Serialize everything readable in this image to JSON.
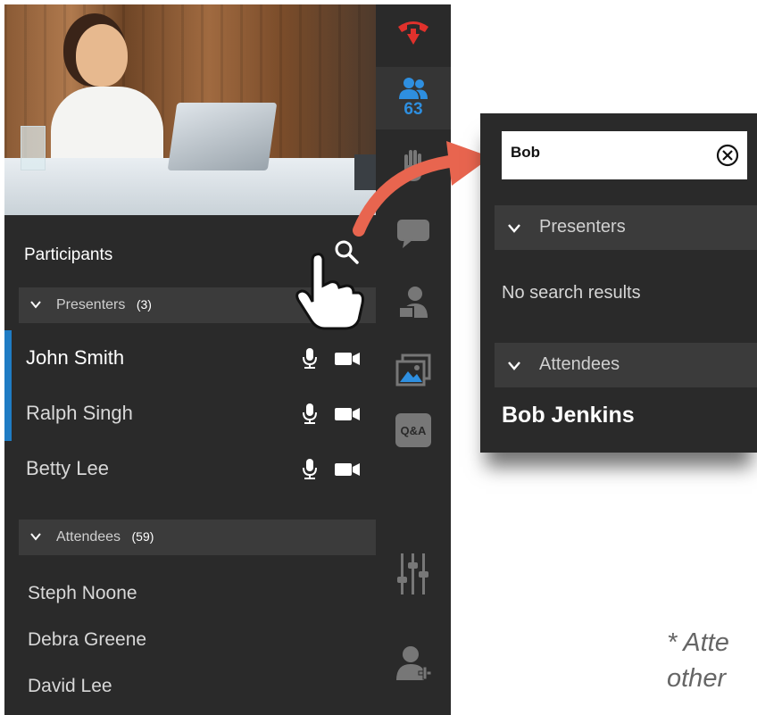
{
  "panel": {
    "title": "Participants",
    "presenters_label": "Presenters",
    "presenters_count": "(3)",
    "presenters": [
      {
        "name": "John Smith",
        "active": true,
        "accent": true
      },
      {
        "name": "Ralph Singh",
        "active": false,
        "accent": true
      },
      {
        "name": "Betty Lee",
        "active": false,
        "accent": false
      }
    ],
    "attendees_label": "Attendees",
    "attendees_count": "(59)",
    "attendees": [
      "Steph Noone",
      "Debra Greene",
      "David Lee"
    ]
  },
  "toolbar": {
    "participants_count": "63",
    "qa_label": "Q&A"
  },
  "zoom": {
    "search_value": "Bob",
    "presenters_label": "Presenters",
    "no_results": "No search results",
    "attendees_label": "Attendees",
    "result_name": "Bob Jenkins"
  },
  "note": {
    "line1": "* Atte",
    "line2": "other"
  },
  "colors": {
    "panel_bg": "#2a2a2a",
    "accent": "#1f7cc4",
    "hangup": "#e0312c",
    "participants_icon": "#2e8fe0",
    "arrow": "#e8654f"
  },
  "icons": [
    "hang-up-icon",
    "participants-icon",
    "raise-hand-icon",
    "chat-icon",
    "share-screen-icon",
    "image-icon",
    "qa-icon",
    "audio-settings-icon",
    "add-user-icon",
    "search-icon",
    "microphone-icon",
    "camera-icon",
    "chevron-down-icon",
    "clear-icon",
    "pointer-hand-icon"
  ]
}
